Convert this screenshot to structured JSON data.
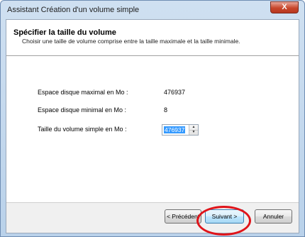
{
  "window": {
    "title": "Assistant Création d'un volume simple",
    "close_glyph": "X"
  },
  "header": {
    "title": "Spécifier la taille du volume",
    "subtitle": "Choisir une taille de volume comprise entre la taille maximale et la taille minimale."
  },
  "fields": {
    "max_label": "Espace disque maximal en Mo :",
    "max_value": "476937",
    "min_label": "Espace disque minimal en Mo :",
    "min_value": "8",
    "size_label": "Taille du volume simple en Mo :",
    "size_value": "476937"
  },
  "buttons": {
    "back": "< Précédent",
    "next": "Suivant >",
    "cancel": "Annuler"
  },
  "colors": {
    "annotation": "#e0141a",
    "selection": "#3399ff"
  }
}
